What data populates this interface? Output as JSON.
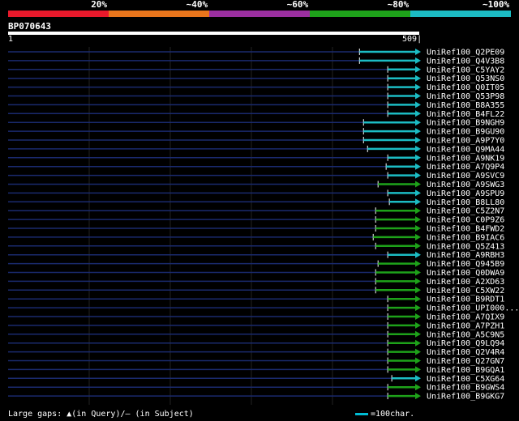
{
  "legend": {
    "labels": [
      "20%",
      "~40%",
      "~60%",
      "~80%",
      "~100%"
    ],
    "colors": [
      "#e8192b",
      "#e8751c",
      "#9b2fa0",
      "#1ea21a",
      "#1cbcc4"
    ]
  },
  "query": {
    "id": "BP070643",
    "start": "1",
    "end": "509",
    "length": 509
  },
  "hits": [
    {
      "name": "UniRef100_Q2PE09",
      "start": 435,
      "identity_color": "#1cbcc4"
    },
    {
      "name": "UniRef100_Q4V3B8",
      "start": 435,
      "identity_color": "#1cbcc4"
    },
    {
      "name": "UniRef100_C5YAY2",
      "start": 470,
      "identity_color": "#1cbcc4"
    },
    {
      "name": "UniRef100_Q53NS0",
      "start": 470,
      "identity_color": "#1cbcc4"
    },
    {
      "name": "UniRef100_Q0IT05",
      "start": 470,
      "identity_color": "#1cbcc4"
    },
    {
      "name": "UniRef100_Q53P98",
      "start": 470,
      "identity_color": "#1cbcc4"
    },
    {
      "name": "UniRef100_B8A355",
      "start": 470,
      "identity_color": "#1cbcc4"
    },
    {
      "name": "UniRef100_B4FL22",
      "start": 470,
      "identity_color": "#1cbcc4"
    },
    {
      "name": "UniRef100_B9NGH9",
      "start": 440,
      "identity_color": "#1cbcc4"
    },
    {
      "name": "UniRef100_B9GU90",
      "start": 440,
      "identity_color": "#1cbcc4"
    },
    {
      "name": "UniRef100_A9P7Y0",
      "start": 440,
      "identity_color": "#1cbcc4"
    },
    {
      "name": "UniRef100_Q9MA44",
      "start": 445,
      "identity_color": "#1cbcc4"
    },
    {
      "name": "UniRef100_A9NK19",
      "start": 470,
      "identity_color": "#1cbcc4"
    },
    {
      "name": "UniRef100_A7Q9P4",
      "start": 468,
      "identity_color": "#1cbcc4"
    },
    {
      "name": "UniRef100_A9SVC9",
      "start": 470,
      "identity_color": "#1cbcc4"
    },
    {
      "name": "UniRef100_A9SWG3",
      "start": 458,
      "identity_color": "#1ea21a"
    },
    {
      "name": "UniRef100_A9SPU9",
      "start": 470,
      "identity_color": "#1cbcc4"
    },
    {
      "name": "UniRef100_B8LL80",
      "start": 472,
      "identity_color": "#1cbcc4"
    },
    {
      "name": "UniRef100_C5Z2N7",
      "start": 455,
      "identity_color": "#1ea21a"
    },
    {
      "name": "UniRef100_C0P9Z6",
      "start": 455,
      "identity_color": "#1ea21a"
    },
    {
      "name": "UniRef100_B4FWD2",
      "start": 455,
      "identity_color": "#1ea21a"
    },
    {
      "name": "UniRef100_B9IAC6",
      "start": 452,
      "identity_color": "#1ea21a"
    },
    {
      "name": "UniRef100_Q5Z413",
      "start": 455,
      "identity_color": "#1ea21a"
    },
    {
      "name": "UniRef100_A9RBH3",
      "start": 470,
      "identity_color": "#1cbcc4"
    },
    {
      "name": "UniRef100_Q945B9",
      "start": 458,
      "identity_color": "#1ea21a"
    },
    {
      "name": "UniRef100_Q0DWA9",
      "start": 455,
      "identity_color": "#1ea21a"
    },
    {
      "name": "UniRef100_A2XD63",
      "start": 455,
      "identity_color": "#1ea21a"
    },
    {
      "name": "UniRef100_C5XW22",
      "start": 455,
      "identity_color": "#1ea21a"
    },
    {
      "name": "UniRef100_B9RDT1",
      "start": 470,
      "identity_color": "#1ea21a"
    },
    {
      "name": "UniRef100_UPI000...",
      "start": 470,
      "identity_color": "#1ea21a"
    },
    {
      "name": "UniRef100_A7QIX9",
      "start": 470,
      "identity_color": "#1ea21a"
    },
    {
      "name": "UniRef100_A7PZH1",
      "start": 470,
      "identity_color": "#1ea21a"
    },
    {
      "name": "UniRef100_A5C9N5",
      "start": 470,
      "identity_color": "#1ea21a"
    },
    {
      "name": "UniRef100_Q9LQ94",
      "start": 470,
      "identity_color": "#1ea21a"
    },
    {
      "name": "UniRef100_Q2V4R4",
      "start": 470,
      "identity_color": "#1ea21a"
    },
    {
      "name": "UniRef100_Q27GN7",
      "start": 470,
      "identity_color": "#1ea21a"
    },
    {
      "name": "UniRef100_B9GQA1",
      "start": 470,
      "identity_color": "#1ea21a"
    },
    {
      "name": "UniRef100_C5XG64",
      "start": 475,
      "identity_color": "#1cbcc4"
    },
    {
      "name": "UniRef100_B9GWS4",
      "start": 470,
      "identity_color": "#1ea21a"
    },
    {
      "name": "UniRef100_B9GKG7",
      "start": 470,
      "identity_color": "#1ea21a"
    }
  ],
  "footer": {
    "gaps_label": "Large gaps: ▲(in Query)/— (in Subject)",
    "scale_label": "=100char."
  }
}
